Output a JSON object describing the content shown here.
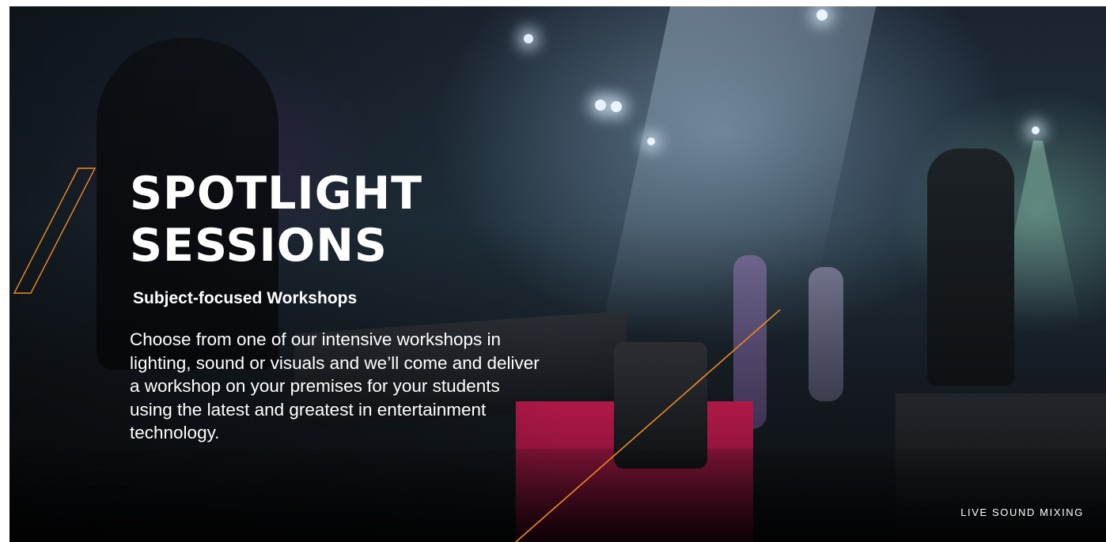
{
  "hero": {
    "title_line1": "SPOTLIGHT",
    "title_line2": "SESSIONS",
    "subtitle": "Subject-focused Workshops",
    "description": "Choose from one of our intensive workshops in lighting, sound or visuals and we’ll come and deliver a workshop on your premises for your students using the latest and greatest in entertainment technology.",
    "caption": "LIVE SOUND MIXING"
  },
  "colors": {
    "accent": "#f08a24",
    "text": "#ffffff"
  }
}
